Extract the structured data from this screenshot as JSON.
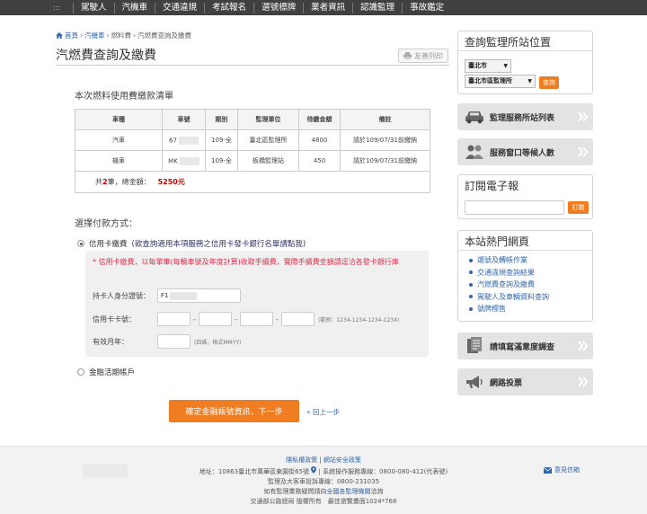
{
  "topnav": {
    "dots": ":::",
    "items": [
      "駕駛人",
      "汽機車",
      "交通違規",
      "考試報名",
      "選號標牌",
      "業者資訊",
      "認識監理",
      "事故鑑定"
    ]
  },
  "breadcrumb": {
    "home": "首頁",
    "sep": "›",
    "items": [
      "汽機車",
      "燃料費",
      "汽燃費查詢及繳費"
    ]
  },
  "page_title": "汽燃費查詢及繳費",
  "print_label": "友善列印",
  "bill": {
    "title": "本次燃料使用費繳款清單",
    "columns": [
      "車種",
      "車號",
      "期別",
      "監理單位",
      "待繳金額",
      "備註"
    ],
    "rows": [
      {
        "type": "汽車",
        "plate": "67",
        "period": "109-全",
        "office": "臺北區監理所",
        "amount": "4800",
        "note": "請於109/07/31前繳納"
      },
      {
        "type": "機車",
        "plate": "MK",
        "period": "109-全",
        "office": "板橋監理站",
        "amount": "450",
        "note": "請於109/07/31前繳納"
      }
    ],
    "total_prefix": "共",
    "total_count": "2",
    "total_mid": "筆，總金額：",
    "total_amount": "5250元"
  },
  "payment": {
    "title": "選擇付款方式：",
    "credit_label": "信用卡繳費",
    "credit_link": "(欲查詢適用本項服務之信用卡發卡銀行名單請點我)",
    "note": "* 信用卡繳費，以每單筆(每輛車號及年度計算)收取手續費，實際手續費金額請逕洽各發卡銀行庫",
    "id_label": "持卡人身分證號：",
    "id_value": "F1",
    "card_label": "信用卡卡號：",
    "card_sep": "-",
    "card_hint": "(範例：1234-1234-1234-1234)",
    "expiry_label": "有效月年：",
    "expiry_hint": "(四碼，格式MMYY)",
    "bank_label": "金融活期帳戶"
  },
  "actions": {
    "submit": "確定金融帳號資訊，下一步",
    "back": "« 回上一步"
  },
  "sidebar": {
    "locate": {
      "title": "查詢監理所站位置",
      "city": "臺北市",
      "office": "臺北市區監理所",
      "search": "查詢"
    },
    "feature1": "監理服務所站列表",
    "feature2": "服務窗口等候人數",
    "subscribe": {
      "title": "訂閱電子報",
      "button": "訂閱"
    },
    "hot": {
      "title": "本站熱門網頁",
      "links": [
        "選號及轉帳作業",
        "交通違規查詢結果",
        "汽燃費查詢及繳費",
        "駕駛人及車輛資料查詢",
        "號牌標售"
      ]
    },
    "feature3": "請填寫滿意度調查",
    "feature4": "網路投票"
  },
  "footer": {
    "privacy": "隱私權政策",
    "sep": "|",
    "security": "網站安全政策",
    "line1": "地址：10863臺北市萬華區東園街65號",
    "line1b": "系統操作服務專線：0800-080-412(代表號)",
    "line2": "監理及大客車投訴專線：0800-231035",
    "line3_pre": "如有監理業務疑問請向",
    "line3_link": "全國各監理機關",
    "line3_post": "洽詢",
    "line4": "交通部公路總局 版權所有　最佳瀏覽畫面1024*768",
    "mail": "意見信箱"
  },
  "colors": {
    "accent": "#f07d22",
    "nav_bg": "#404040",
    "link": "#3366aa",
    "warn": "#d9314f"
  }
}
